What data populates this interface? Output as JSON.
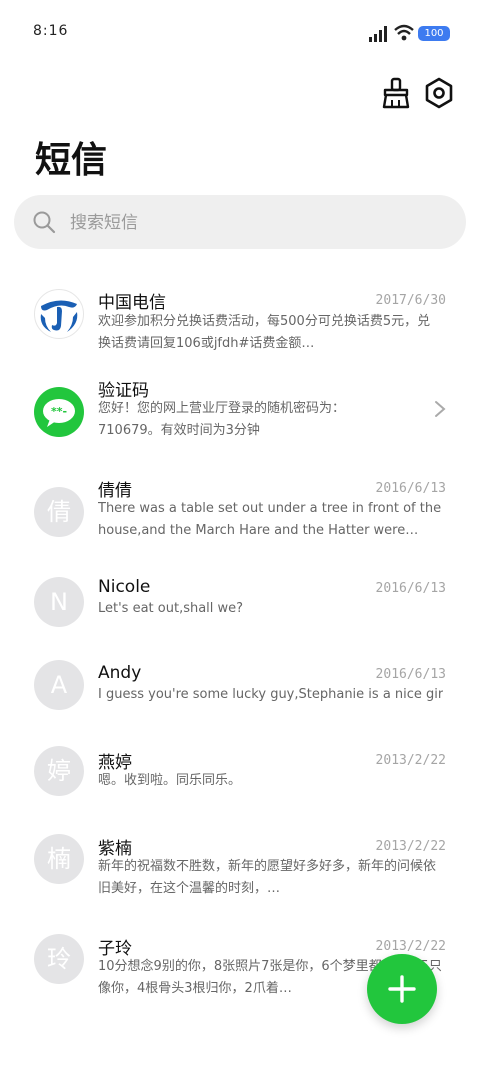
{
  "status": {
    "time": "8:16",
    "battery": "100"
  },
  "header": {
    "title": "短信"
  },
  "search": {
    "placeholder": "搜索短信"
  },
  "conversations": [
    {
      "name": "中国电信",
      "date": "2017/6/30",
      "preview": "欢迎参加积分兑换话费活动，每500分可兑换话费5元，兑换话费请回复106或jfdh#话费金额…",
      "avatar": "china-telecom-logo"
    },
    {
      "name": "验证码",
      "date": "",
      "preview": "您好！您的网上营业厅登录的随机密码为：710679。有效时间为3分钟",
      "avatar": "message-bubble-icon"
    },
    {
      "name": "倩倩",
      "date": "2016/6/13",
      "preview": "There was a table set out under a tree in front of the house,and the March Hare and the Hatter were having …",
      "avatar_text": "倩"
    },
    {
      "name": "Nicole",
      "date": "2016/6/13",
      "preview": "Let's eat out,shall we?",
      "avatar_text": "N"
    },
    {
      "name": "Andy",
      "date": "2016/6/13",
      "preview": "I guess you're some lucky guy,Stephanie is a nice girl.",
      "avatar_text": "A"
    },
    {
      "name": "燕婷",
      "date": "2013/2/22",
      "preview": "嗯。收到啦。同乐同乐。",
      "avatar_text": "婷"
    },
    {
      "name": "紫楠",
      "date": "2013/2/22",
      "preview": "新年的祝福数不胜数，新年的愿望好多好多，新年的问候依旧美好，在这个温馨的时刻，…",
      "avatar_text": "楠"
    },
    {
      "name": "子玲",
      "date": "2013/2/22",
      "preview": "10分想念9别的你，8张照片7张是你，6个梦里都是你，5只像你，4根骨头3根归你，2爪着…",
      "avatar_text": "玲"
    }
  ],
  "colors": {
    "accent_green": "#22c63d",
    "telecom_blue": "#1a5fb4",
    "avatar_gray": "#e4e4e6"
  }
}
